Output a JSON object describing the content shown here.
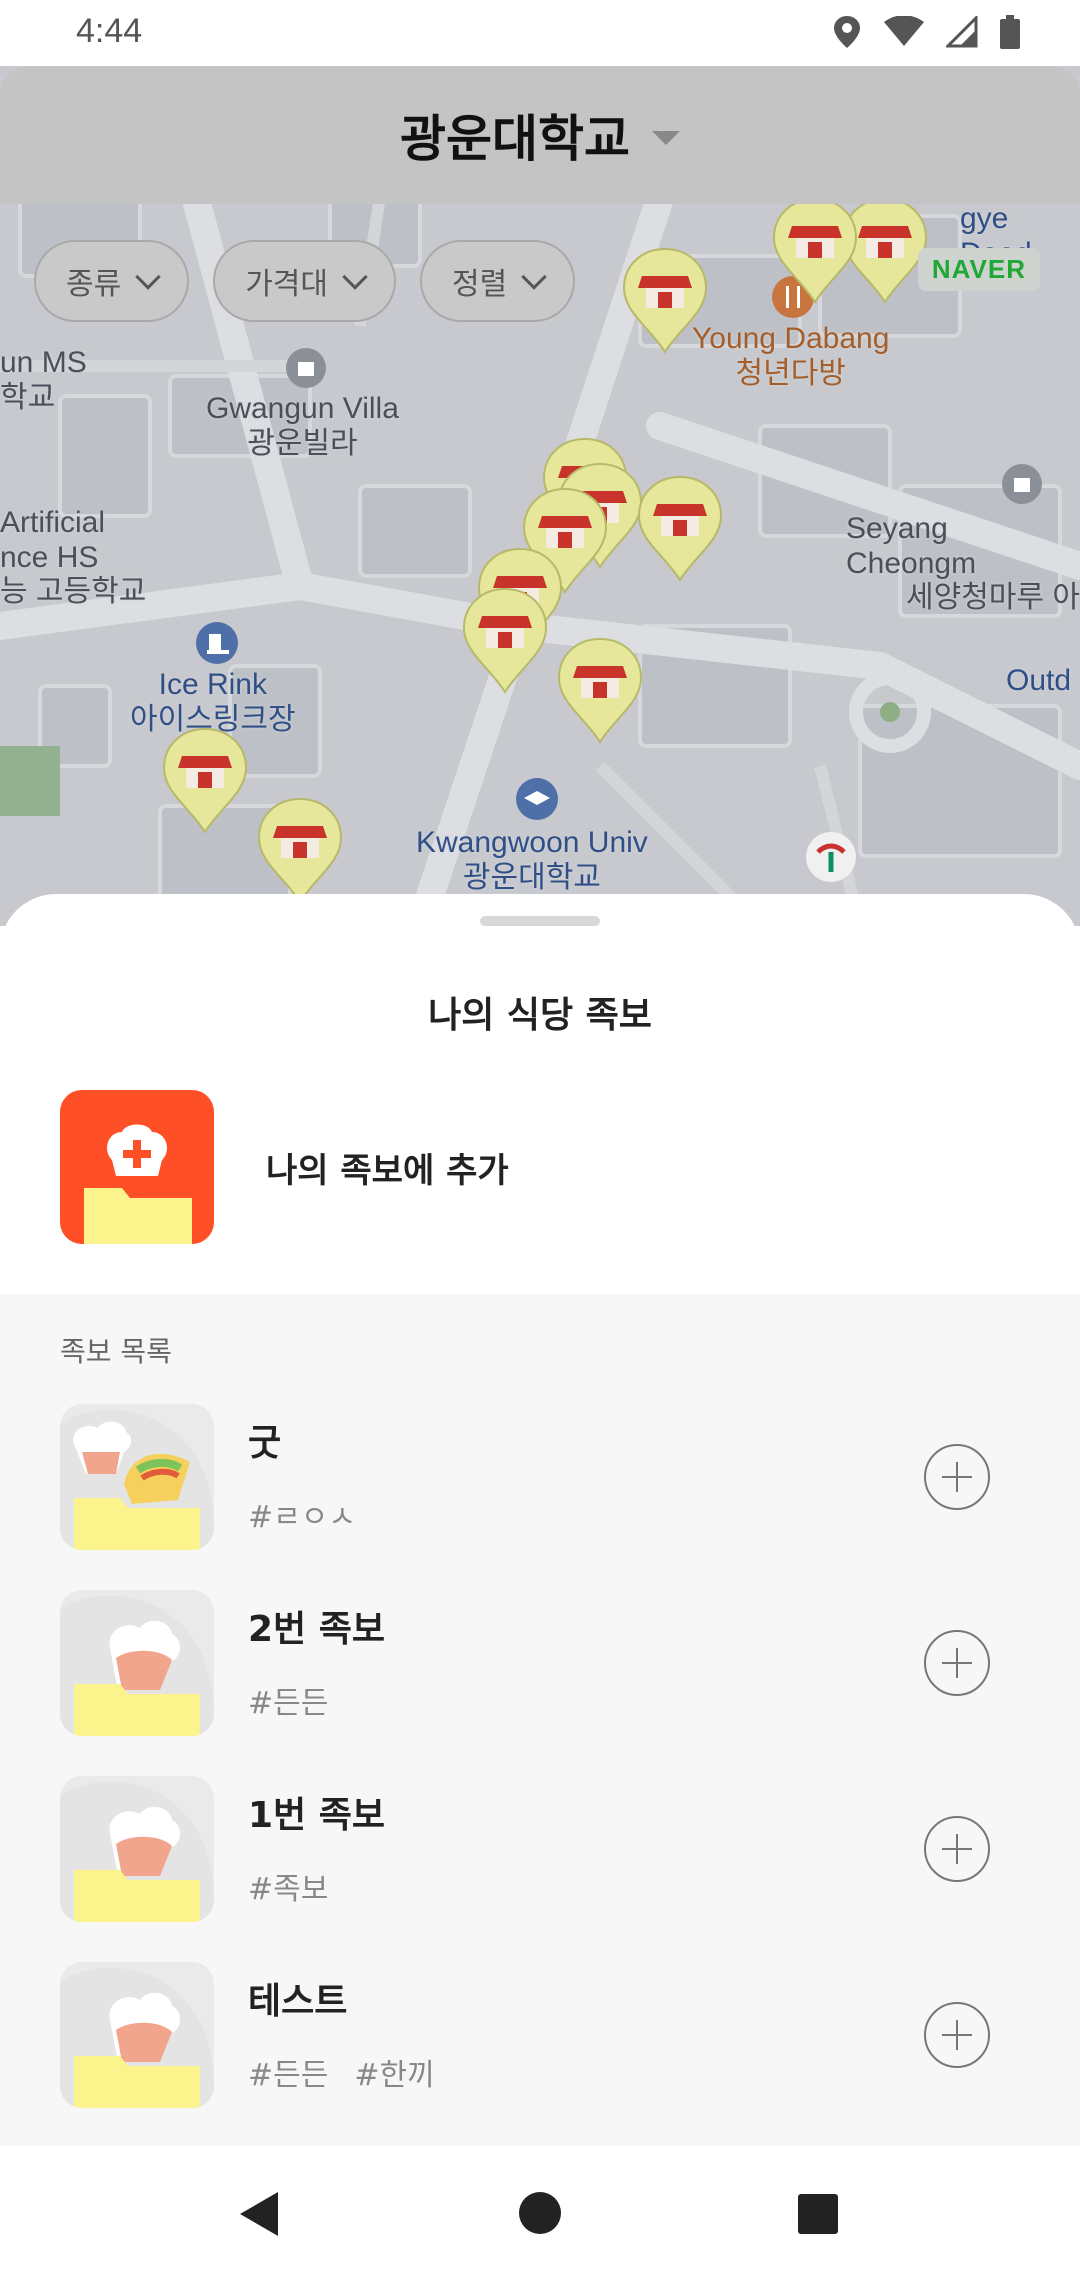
{
  "status_bar": {
    "time": "4:44",
    "icons": [
      "location-icon",
      "wifi-icon",
      "signal-icon",
      "battery-icon"
    ]
  },
  "header": {
    "region": "광운대학교"
  },
  "filters": [
    {
      "label": "종류"
    },
    {
      "label": "가격대"
    },
    {
      "label": "정렬"
    }
  ],
  "map": {
    "provider": "NAVER",
    "labels": {
      "young_dabang_en": "Young Dabang",
      "young_dabang_ko": "청년다방",
      "gwangun_villa_en": "Gwangun Villa",
      "gwangun_villa_ko": "광운빌라",
      "seyang_en": "Seyang Cheongm",
      "seyang_ko": "세양청마루 아",
      "ai_en_1": "Artificial",
      "ai_en_2": "nce HS",
      "ai_ko": "능 고등학교",
      "un_ms": "un MS",
      "hakgyo": "학교",
      "ice_rink_en": "Ice Rink",
      "ice_rink_ko": "아이스링크장",
      "kw_univ_en": "Kwangwoon Univ",
      "kw_univ_ko": "광운대학교",
      "daed": "gye Daed",
      "outd": "Outd"
    }
  },
  "sheet": {
    "title": "나의 식당 족보",
    "add_label": "나의 족보에 추가",
    "list_header": "족보 목록",
    "items": [
      {
        "name": "굿",
        "tags": [
          "#ㄹㅇㅅ"
        ]
      },
      {
        "name": "2번 족보",
        "tags": [
          "#든든"
        ]
      },
      {
        "name": "1번 족보",
        "tags": [
          "#족보"
        ]
      },
      {
        "name": "테스트",
        "tags": [
          "#든든",
          "#한끼"
        ]
      }
    ]
  },
  "colors": {
    "accent": "#ff4f26",
    "folder": "#fbf38b",
    "pin": "#e7e79b",
    "store_red": "#c8332b"
  }
}
